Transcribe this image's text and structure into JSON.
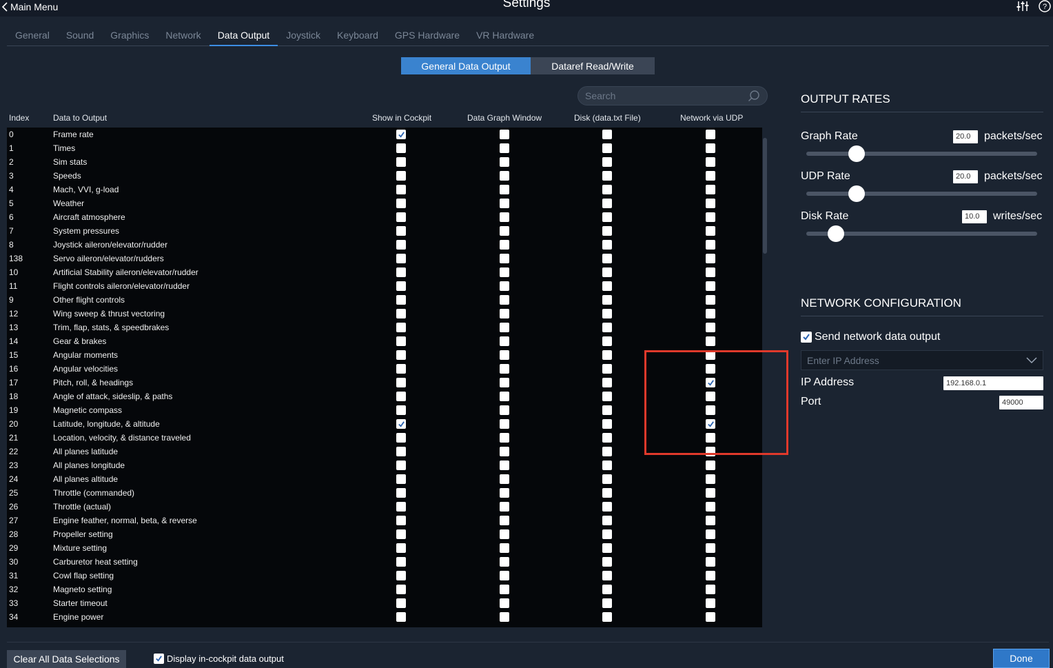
{
  "window": {
    "title": "Settings",
    "back_label": "Main Menu"
  },
  "tabs": [
    "General",
    "Sound",
    "Graphics",
    "Network",
    "Data Output",
    "Joystick",
    "Keyboard",
    "GPS Hardware",
    "VR Hardware"
  ],
  "active_tab": "Data Output",
  "segments": {
    "general": "General Data Output",
    "dataref": "Dataref Read/Write"
  },
  "search": {
    "placeholder": "Search"
  },
  "columns": {
    "index": "Index",
    "data": "Data to Output",
    "cockpit": "Show in Cockpit",
    "graph": "Data Graph Window",
    "disk": "Disk (data.txt File)",
    "udp": "Network via UDP"
  },
  "rows": [
    {
      "index": "0",
      "name": "Frame rate",
      "cockpit": true,
      "graph": false,
      "disk": false,
      "udp": false
    },
    {
      "index": "1",
      "name": "Times",
      "cockpit": false,
      "graph": false,
      "disk": false,
      "udp": false
    },
    {
      "index": "2",
      "name": "Sim stats",
      "cockpit": false,
      "graph": false,
      "disk": false,
      "udp": false
    },
    {
      "index": "3",
      "name": "Speeds",
      "cockpit": false,
      "graph": false,
      "disk": false,
      "udp": false
    },
    {
      "index": "4",
      "name": "Mach, VVI, g-load",
      "cockpit": false,
      "graph": false,
      "disk": false,
      "udp": false
    },
    {
      "index": "5",
      "name": "Weather",
      "cockpit": false,
      "graph": false,
      "disk": false,
      "udp": false
    },
    {
      "index": "6",
      "name": "Aircraft atmosphere",
      "cockpit": false,
      "graph": false,
      "disk": false,
      "udp": false
    },
    {
      "index": "7",
      "name": "System pressures",
      "cockpit": false,
      "graph": false,
      "disk": false,
      "udp": false
    },
    {
      "index": "8",
      "name": "Joystick aileron/elevator/rudder",
      "cockpit": false,
      "graph": false,
      "disk": false,
      "udp": false
    },
    {
      "index": "138",
      "name": "Servo aileron/elevator/rudders",
      "cockpit": false,
      "graph": false,
      "disk": false,
      "udp": false
    },
    {
      "index": "10",
      "name": "Artificial Stability aileron/elevator/rudder",
      "cockpit": false,
      "graph": false,
      "disk": false,
      "udp": false
    },
    {
      "index": "11",
      "name": "Flight controls aileron/elevator/rudder",
      "cockpit": false,
      "graph": false,
      "disk": false,
      "udp": false
    },
    {
      "index": "9",
      "name": "Other flight controls",
      "cockpit": false,
      "graph": false,
      "disk": false,
      "udp": false
    },
    {
      "index": "12",
      "name": "Wing sweep & thrust vectoring",
      "cockpit": false,
      "graph": false,
      "disk": false,
      "udp": false
    },
    {
      "index": "13",
      "name": "Trim, flap, stats, & speedbrakes",
      "cockpit": false,
      "graph": false,
      "disk": false,
      "udp": false
    },
    {
      "index": "14",
      "name": "Gear & brakes",
      "cockpit": false,
      "graph": false,
      "disk": false,
      "udp": false
    },
    {
      "index": "15",
      "name": "Angular moments",
      "cockpit": false,
      "graph": false,
      "disk": false,
      "udp": false
    },
    {
      "index": "16",
      "name": "Angular velocities",
      "cockpit": false,
      "graph": false,
      "disk": false,
      "udp": false
    },
    {
      "index": "17",
      "name": "Pitch, roll, & headings",
      "cockpit": false,
      "graph": false,
      "disk": false,
      "udp": true
    },
    {
      "index": "18",
      "name": "Angle of attack, sideslip, & paths",
      "cockpit": false,
      "graph": false,
      "disk": false,
      "udp": false
    },
    {
      "index": "19",
      "name": "Magnetic compass",
      "cockpit": false,
      "graph": false,
      "disk": false,
      "udp": false
    },
    {
      "index": "20",
      "name": "Latitude, longitude, & altitude",
      "cockpit": true,
      "graph": false,
      "disk": false,
      "udp": true
    },
    {
      "index": "21",
      "name": "Location, velocity, & distance traveled",
      "cockpit": false,
      "graph": false,
      "disk": false,
      "udp": false
    },
    {
      "index": "22",
      "name": "All planes latitude",
      "cockpit": false,
      "graph": false,
      "disk": false,
      "udp": false
    },
    {
      "index": "23",
      "name": "All planes longitude",
      "cockpit": false,
      "graph": false,
      "disk": false,
      "udp": false
    },
    {
      "index": "24",
      "name": "All planes altitude",
      "cockpit": false,
      "graph": false,
      "disk": false,
      "udp": false
    },
    {
      "index": "25",
      "name": "Throttle (commanded)",
      "cockpit": false,
      "graph": false,
      "disk": false,
      "udp": false
    },
    {
      "index": "26",
      "name": "Throttle (actual)",
      "cockpit": false,
      "graph": false,
      "disk": false,
      "udp": false
    },
    {
      "index": "27",
      "name": "Engine feather, normal, beta, & reverse",
      "cockpit": false,
      "graph": false,
      "disk": false,
      "udp": false
    },
    {
      "index": "28",
      "name": "Propeller setting",
      "cockpit": false,
      "graph": false,
      "disk": false,
      "udp": false
    },
    {
      "index": "29",
      "name": "Mixture setting",
      "cockpit": false,
      "graph": false,
      "disk": false,
      "udp": false
    },
    {
      "index": "30",
      "name": "Carburetor heat setting",
      "cockpit": false,
      "graph": false,
      "disk": false,
      "udp": false
    },
    {
      "index": "31",
      "name": "Cowl flap setting",
      "cockpit": false,
      "graph": false,
      "disk": false,
      "udp": false
    },
    {
      "index": "32",
      "name": "Magneto setting",
      "cockpit": false,
      "graph": false,
      "disk": false,
      "udp": false
    },
    {
      "index": "33",
      "name": "Starter timeout",
      "cockpit": false,
      "graph": false,
      "disk": false,
      "udp": false
    },
    {
      "index": "34",
      "name": "Engine power",
      "cockpit": false,
      "graph": false,
      "disk": false,
      "udp": false
    }
  ],
  "output_rates": {
    "title": "OUTPUT RATES",
    "graph": {
      "label": "Graph Rate",
      "value": "20.0",
      "unit": "packets/sec",
      "level": 0.2
    },
    "udp": {
      "label": "UDP Rate",
      "value": "20.0",
      "unit": "packets/sec",
      "level": 0.2
    },
    "disk": {
      "label": "Disk Rate",
      "value": "10.0",
      "unit": "writes/sec",
      "level": 0.1
    }
  },
  "network": {
    "title": "NETWORK CONFIGURATION",
    "send_label": "Send network data output",
    "send_checked": true,
    "ip_placeholder": "Enter IP Address",
    "ip_label": "IP Address",
    "ip_value": "192.168.0.1",
    "port_label": "Port",
    "port_value": "49000"
  },
  "bottom": {
    "clear_label": "Clear All Data Selections",
    "display_label": "Display in-cockpit data output",
    "display_checked": true,
    "done_label": "Done"
  },
  "colors": {
    "accent": "#3a83cf",
    "highlight": "#e0392b",
    "check": "#2a62b0"
  }
}
